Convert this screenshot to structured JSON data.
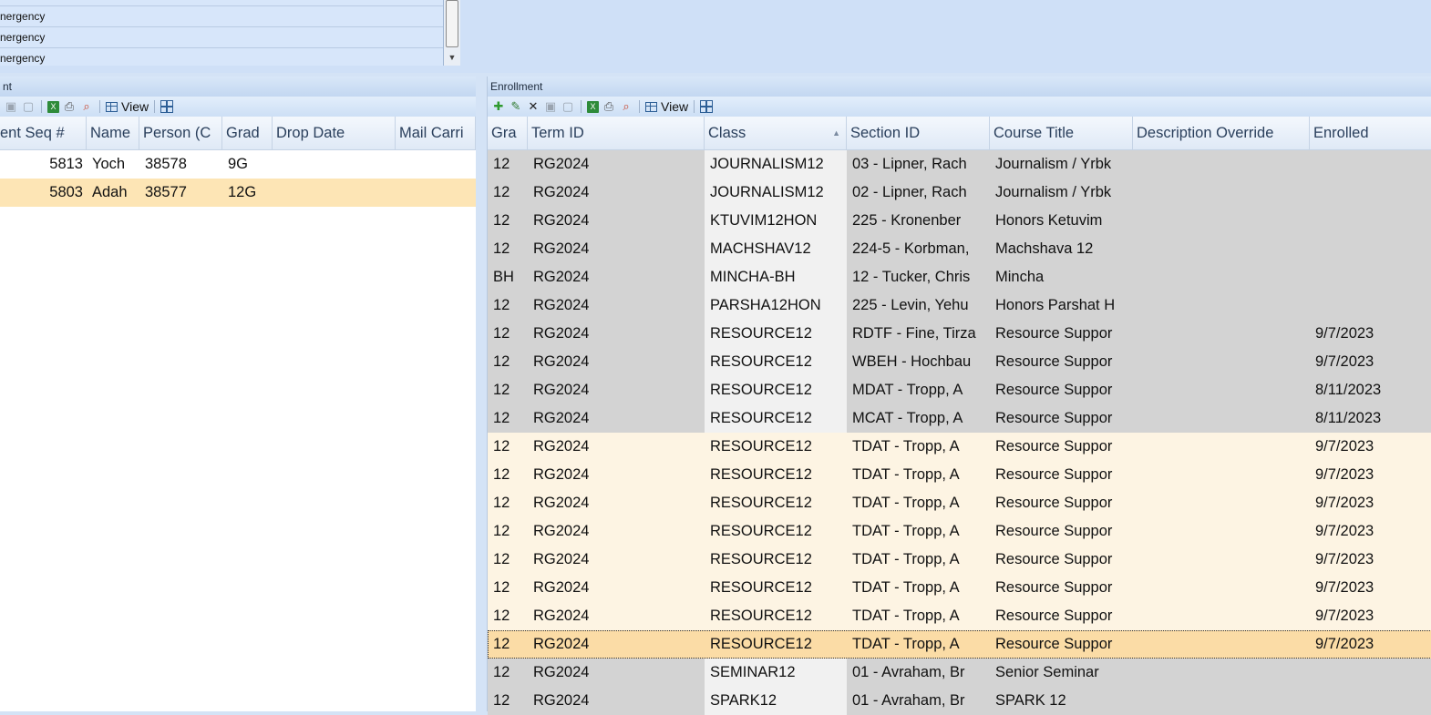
{
  "top_list": {
    "rows": [
      "",
      "nergency",
      "nergency",
      "nergency"
    ]
  },
  "left_panel": {
    "title": "nt",
    "toolbar": {
      "view_label": "View"
    },
    "columns": [
      "ent Seq #",
      "Name",
      "Person (C",
      "Grad",
      "Drop Date",
      "Mail Carri"
    ],
    "rows": [
      {
        "seq": "5813",
        "name": "Yoch",
        "person": "38578",
        "grad": "9G",
        "drop": "",
        "mail": ""
      },
      {
        "seq": "5803",
        "name": "Adah",
        "person": "38577",
        "grad": "12G",
        "drop": "",
        "mail": ""
      }
    ],
    "selected_row": 1
  },
  "right_panel": {
    "title": "Enrollment",
    "toolbar": {
      "view_label": "View"
    },
    "columns": [
      "Gra",
      "Term ID",
      "Class",
      "Section ID",
      "Course Title",
      "Description Override",
      "Enrolled"
    ],
    "rows": [
      {
        "gra": "12",
        "term": "RG2024",
        "class": "JOURNALISM12",
        "section": "03 - Lipner, Rach",
        "course": "Journalism / Yrbk",
        "desc": "",
        "enrolled": "",
        "state": "normal"
      },
      {
        "gra": "12",
        "term": "RG2024",
        "class": "JOURNALISM12",
        "section": "02 - Lipner, Rach",
        "course": "Journalism / Yrbk",
        "desc": "",
        "enrolled": "",
        "state": "normal"
      },
      {
        "gra": "12",
        "term": "RG2024",
        "class": "KTUVIM12HON",
        "section": "225 - Kronenber",
        "course": "Honors Ketuvim",
        "desc": "",
        "enrolled": "",
        "state": "normal"
      },
      {
        "gra": "12",
        "term": "RG2024",
        "class": "MACHSHAV12",
        "section": "224-5 - Korbman,",
        "course": "Machshava 12",
        "desc": "",
        "enrolled": "",
        "state": "normal"
      },
      {
        "gra": "BH",
        "term": "RG2024",
        "class": "MINCHA-BH",
        "section": "12 - Tucker, Chris",
        "course": "Mincha",
        "desc": "",
        "enrolled": "",
        "state": "normal"
      },
      {
        "gra": "12",
        "term": "RG2024",
        "class": "PARSHA12HON",
        "section": "225 - Levin, Yehu",
        "course": "Honors Parshat H",
        "desc": "",
        "enrolled": "",
        "state": "normal"
      },
      {
        "gra": "12",
        "term": "RG2024",
        "class": "RESOURCE12",
        "section": "RDTF - Fine, Tirza",
        "course": "Resource Suppor",
        "desc": "",
        "enrolled": "9/7/2023",
        "state": "normal"
      },
      {
        "gra": "12",
        "term": "RG2024",
        "class": "RESOURCE12",
        "section": "WBEH - Hochbau",
        "course": "Resource Suppor",
        "desc": "",
        "enrolled": "9/7/2023",
        "state": "normal"
      },
      {
        "gra": "12",
        "term": "RG2024",
        "class": "RESOURCE12",
        "section": "MDAT - Tropp, A",
        "course": "Resource Suppor",
        "desc": "",
        "enrolled": "8/11/2023",
        "state": "normal"
      },
      {
        "gra": "12",
        "term": "RG2024",
        "class": "RESOURCE12",
        "section": "MCAT - Tropp, A",
        "course": "Resource Suppor",
        "desc": "",
        "enrolled": "8/11/2023",
        "state": "normal"
      },
      {
        "gra": "12",
        "term": "RG2024",
        "class": "RESOURCE12",
        "section": "TDAT - Tropp, A",
        "course": "Resource Suppor",
        "desc": "",
        "enrolled": "9/7/2023",
        "state": "hl"
      },
      {
        "gra": "12",
        "term": "RG2024",
        "class": "RESOURCE12",
        "section": "TDAT - Tropp, A",
        "course": "Resource Suppor",
        "desc": "",
        "enrolled": "9/7/2023",
        "state": "hl"
      },
      {
        "gra": "12",
        "term": "RG2024",
        "class": "RESOURCE12",
        "section": "TDAT - Tropp, A",
        "course": "Resource Suppor",
        "desc": "",
        "enrolled": "9/7/2023",
        "state": "hl"
      },
      {
        "gra": "12",
        "term": "RG2024",
        "class": "RESOURCE12",
        "section": "TDAT - Tropp, A",
        "course": "Resource Suppor",
        "desc": "",
        "enrolled": "9/7/2023",
        "state": "hl"
      },
      {
        "gra": "12",
        "term": "RG2024",
        "class": "RESOURCE12",
        "section": "TDAT - Tropp, A",
        "course": "Resource Suppor",
        "desc": "",
        "enrolled": "9/7/2023",
        "state": "hl"
      },
      {
        "gra": "12",
        "term": "RG2024",
        "class": "RESOURCE12",
        "section": "TDAT - Tropp, A",
        "course": "Resource Suppor",
        "desc": "",
        "enrolled": "9/7/2023",
        "state": "hl"
      },
      {
        "gra": "12",
        "term": "RG2024",
        "class": "RESOURCE12",
        "section": "TDAT - Tropp, A",
        "course": "Resource Suppor",
        "desc": "",
        "enrolled": "9/7/2023",
        "state": "hl"
      },
      {
        "gra": "12",
        "term": "RG2024",
        "class": "RESOURCE12",
        "section": "TDAT - Tropp, A",
        "course": "Resource Suppor",
        "desc": "",
        "enrolled": "9/7/2023",
        "state": "cur"
      },
      {
        "gra": "12",
        "term": "RG2024",
        "class": "SEMINAR12",
        "section": "01 - Avraham, Br",
        "course": "Senior Seminar",
        "desc": "",
        "enrolled": "",
        "state": "normal"
      },
      {
        "gra": "12",
        "term": "RG2024",
        "class": "SPARK12",
        "section": "01 - Avraham, Br",
        "course": "SPARK 12",
        "desc": "",
        "enrolled": "",
        "state": "normal"
      }
    ]
  }
}
